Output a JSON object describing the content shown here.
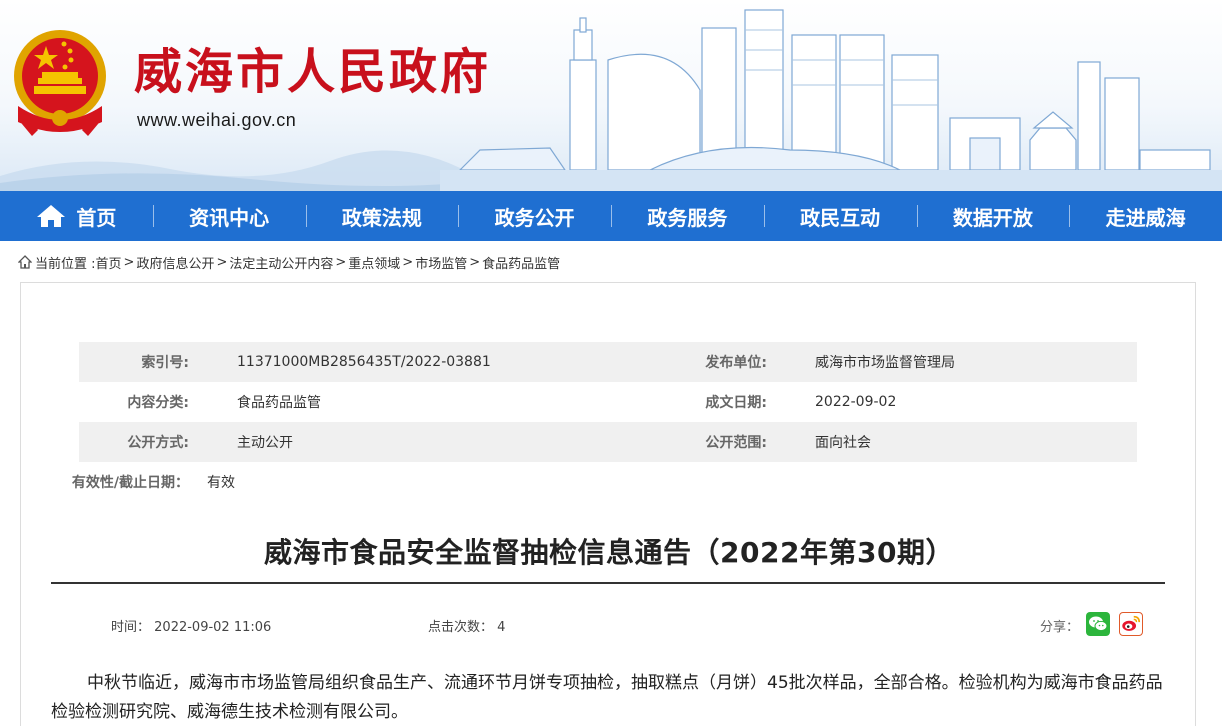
{
  "header": {
    "site_title": "威海市人民政府",
    "site_url": "www.weihai.gov.cn"
  },
  "nav": {
    "items": [
      {
        "label": "首页"
      },
      {
        "label": "资讯中心"
      },
      {
        "label": "政策法规"
      },
      {
        "label": "政务公开"
      },
      {
        "label": "政务服务"
      },
      {
        "label": "政民互动"
      },
      {
        "label": "数据开放"
      },
      {
        "label": "走进威海"
      }
    ]
  },
  "breadcrumb": {
    "prefix": "当前位置 :",
    "items": [
      "首页",
      "政府信息公开",
      "法定主动公开内容",
      "重点领域",
      "市场监管",
      "食品药品监管"
    ],
    "separator": ">"
  },
  "meta": {
    "index_no_label": "索引号:",
    "index_no": "11371000MB2856435T/2022-03881",
    "publisher_label": "发布单位:",
    "publisher": "威海市市场监督管理局",
    "category_label": "内容分类:",
    "category": "食品药品监管",
    "date_label": "成文日期:",
    "date": "2022-09-02",
    "open_mode_label": "公开方式:",
    "open_mode": "主动公开",
    "open_scope_label": "公开范围:",
    "open_scope": "面向社会",
    "validity_label": "有效性/截止日期：",
    "validity": "有效"
  },
  "article": {
    "title": "威海市食品安全监督抽检信息通告（2022年第30期）",
    "time_label": "时间：",
    "time": "2022-09-02 11:06",
    "clicks_label": "点击次数：",
    "clicks": "4",
    "share_label": "分享：",
    "body": "中秋节临近，威海市市场监管局组织食品生产、流通环节月饼专项抽检，抽取糕点（月饼）45批次样品，全部合格。检验机构为威海市食品药品检验检测研究院、威海德生技术检测有限公司。"
  },
  "colors": {
    "nav_bg": "#1f6fd1",
    "title_red": "#c8101c",
    "wechat_green": "#2cb53c",
    "weibo_red": "#e6162d"
  }
}
